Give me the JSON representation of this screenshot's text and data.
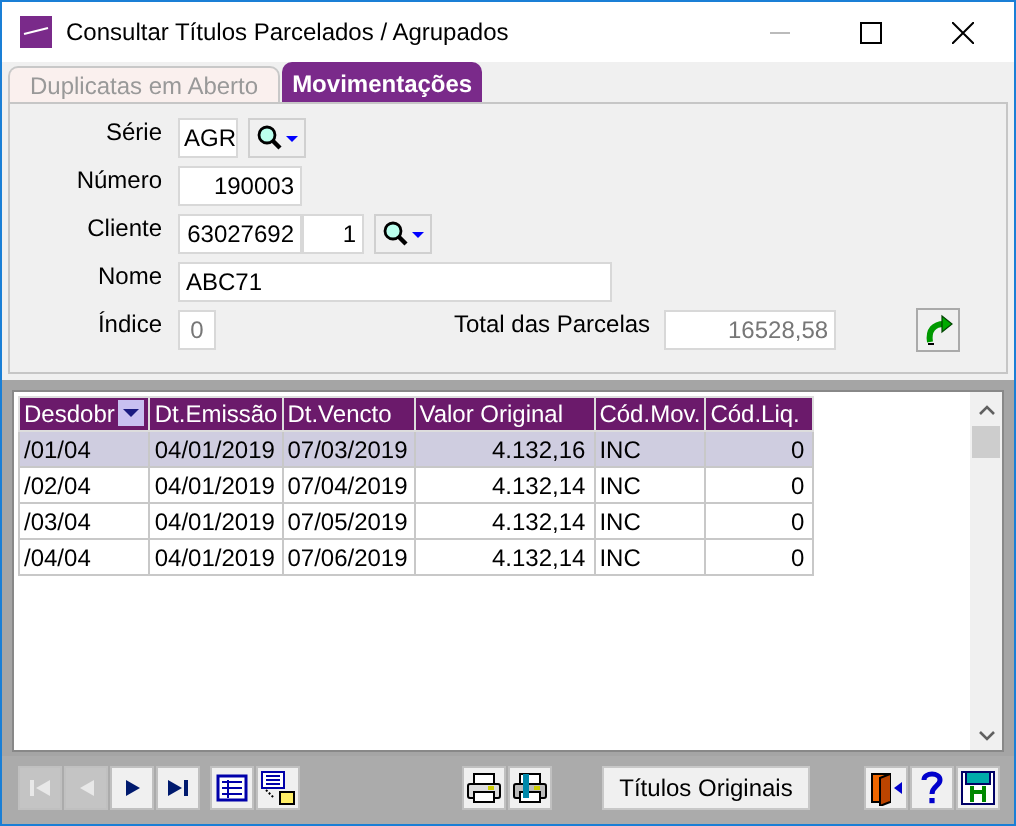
{
  "window": {
    "title": "Consultar Títulos Parcelados / Agrupados"
  },
  "tabs": [
    {
      "label": "Duplicatas em Aberto",
      "selected": false
    },
    {
      "label": "Movimentações",
      "selected": true
    }
  ],
  "form": {
    "serie": {
      "label": "Série",
      "value": "AGR",
      "disabled": false
    },
    "numero": {
      "label": "Número",
      "value": "190003",
      "disabled": false
    },
    "cliente": {
      "label": "Cliente",
      "code": "63027692",
      "branch": "1",
      "disabled": false
    },
    "nome": {
      "label": "Nome",
      "value": "ABC71",
      "disabled": false
    },
    "indice": {
      "label": "Índice",
      "value": "0",
      "disabled": true
    },
    "total": {
      "label": "Total das Parcelas",
      "value": "16528,58",
      "disabled": true
    }
  },
  "grid": {
    "columns": [
      {
        "label": "Desdobr",
        "kind": "text",
        "sorted": true
      },
      {
        "label": "Dt.Emissão",
        "kind": "text",
        "sorted": false
      },
      {
        "label": "Dt.Vencto",
        "kind": "text",
        "sorted": false
      },
      {
        "label": "Valor Original",
        "kind": "number",
        "sorted": false
      },
      {
        "label": "Cód.Mov.",
        "kind": "text",
        "sorted": false
      },
      {
        "label": "Cód.Liq.",
        "kind": "number",
        "sorted": false
      }
    ],
    "rows": [
      {
        "selected": true,
        "cells": [
          "/01/04",
          "04/01/2019",
          "07/03/2019",
          "4.132,16",
          "INC",
          "0"
        ]
      },
      {
        "selected": false,
        "cells": [
          "/02/04",
          "04/01/2019",
          "07/04/2019",
          "4.132,14",
          "INC",
          "0"
        ]
      },
      {
        "selected": false,
        "cells": [
          "/03/04",
          "04/01/2019",
          "07/05/2019",
          "4.132,14",
          "INC",
          "0"
        ]
      },
      {
        "selected": false,
        "cells": [
          "/04/04",
          "04/01/2019",
          "07/06/2019",
          "4.132,14",
          "INC",
          "0"
        ]
      }
    ]
  },
  "toolbar": {
    "nav": [
      {
        "kind": "first",
        "disabled": true
      },
      {
        "kind": "prev",
        "disabled": true
      },
      {
        "kind": "next",
        "disabled": false
      },
      {
        "kind": "last",
        "disabled": false
      }
    ],
    "views": [
      {
        "kind": "form"
      },
      {
        "kind": "export"
      }
    ],
    "print": [
      {
        "kind": "print"
      },
      {
        "kind": "printsetup"
      }
    ],
    "action": {
      "label": "Títulos Originais"
    },
    "end": [
      {
        "kind": "exit"
      },
      {
        "kind": "help"
      },
      {
        "kind": "save"
      }
    ]
  }
}
